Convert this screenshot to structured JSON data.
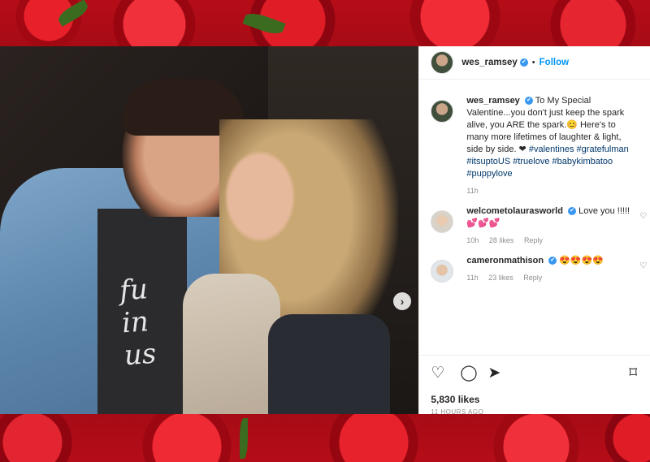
{
  "post": {
    "username": "wes_ramsey",
    "follow_label": "Follow",
    "separator": "•",
    "shirt_text": "fu\nin\nus",
    "caption": {
      "username": "wes_ramsey",
      "text": "To My Special Valentine...you don't just keep the spark alive, you ARE the spark.😊 Here's to many more lifetimes of laughter & light, side by side. ❤",
      "hashtags": "#valentines #gratefulman #itsuptoUS #truelove #babykimbatoo #puppylove",
      "time": "11h"
    },
    "comments": [
      {
        "username": "welcometolaurasworld",
        "text": "Love you !!!!! 💕💕💕",
        "time": "10h",
        "likes": "28 likes",
        "reply": "Reply"
      },
      {
        "username": "cameronmathison",
        "text": "😍😍😍😍",
        "time": "11h",
        "likes": "23 likes",
        "reply": "Reply"
      }
    ],
    "likes_label": "5,830 likes",
    "age_label": "11 HOURS AGO"
  },
  "icons": {
    "verified": "✔",
    "next": "›",
    "heart": "♡",
    "comment": "◯",
    "share": "➤",
    "save": "⌑",
    "small_heart": "♡"
  },
  "colors": {
    "link": "#0095f6",
    "verified": "#3897f0",
    "hashtag": "#00376b"
  }
}
